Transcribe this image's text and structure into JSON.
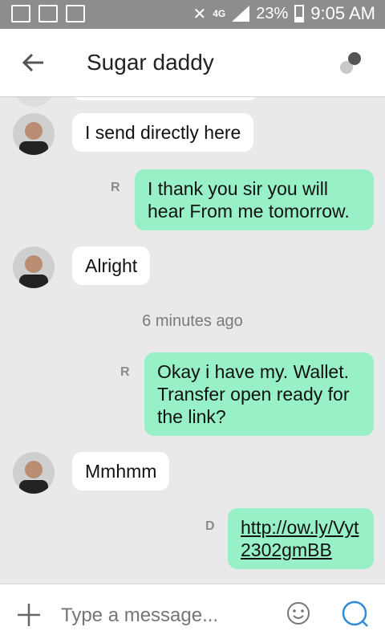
{
  "status": {
    "time": "9:05 AM",
    "battery": "23%",
    "network": "4G"
  },
  "header": {
    "title": "Sugar daddy"
  },
  "messages": [
    {
      "from": "contact",
      "text": "I send directly here"
    },
    {
      "from": "me",
      "text": "I thank you sir you will hear From me tomorrow.",
      "receipt": "R"
    },
    {
      "from": "contact",
      "text": "Alright"
    },
    {
      "from": "me",
      "text": "Okay i have my. Wallet. Transfer open ready for the link?",
      "receipt": "R"
    },
    {
      "from": "contact",
      "text": "Mmhmm"
    },
    {
      "from": "me",
      "text": "http://ow.ly/Vyt2302gmBB",
      "receipt": "D"
    }
  ],
  "timestamp": "6 minutes ago",
  "composer": {
    "placeholder": "Type a message..."
  },
  "colors": {
    "outgoing": "#97f0c6",
    "incoming": "#ffffff",
    "send": "#2f8bd8"
  }
}
